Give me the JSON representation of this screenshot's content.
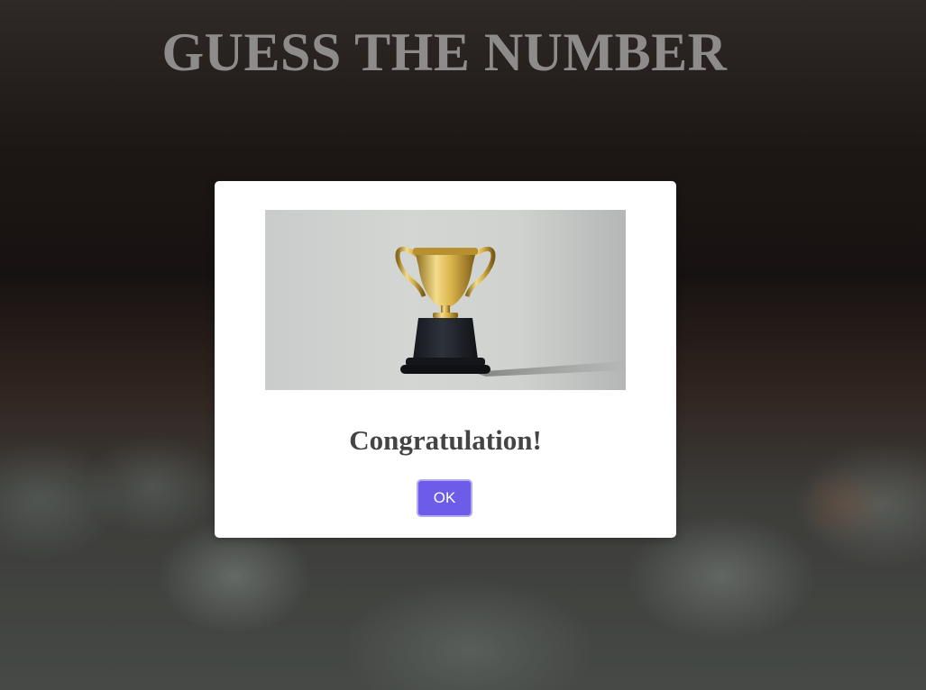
{
  "page": {
    "title": "GUESS THE NUMBER"
  },
  "modal": {
    "image_name": "trophy-icon",
    "message": "Congratulation!",
    "ok_label": "OK"
  },
  "colors": {
    "title": "#8e8c8b",
    "button_bg": "#6c5ce7",
    "button_border": "#b3abf0",
    "message": "#444444"
  }
}
